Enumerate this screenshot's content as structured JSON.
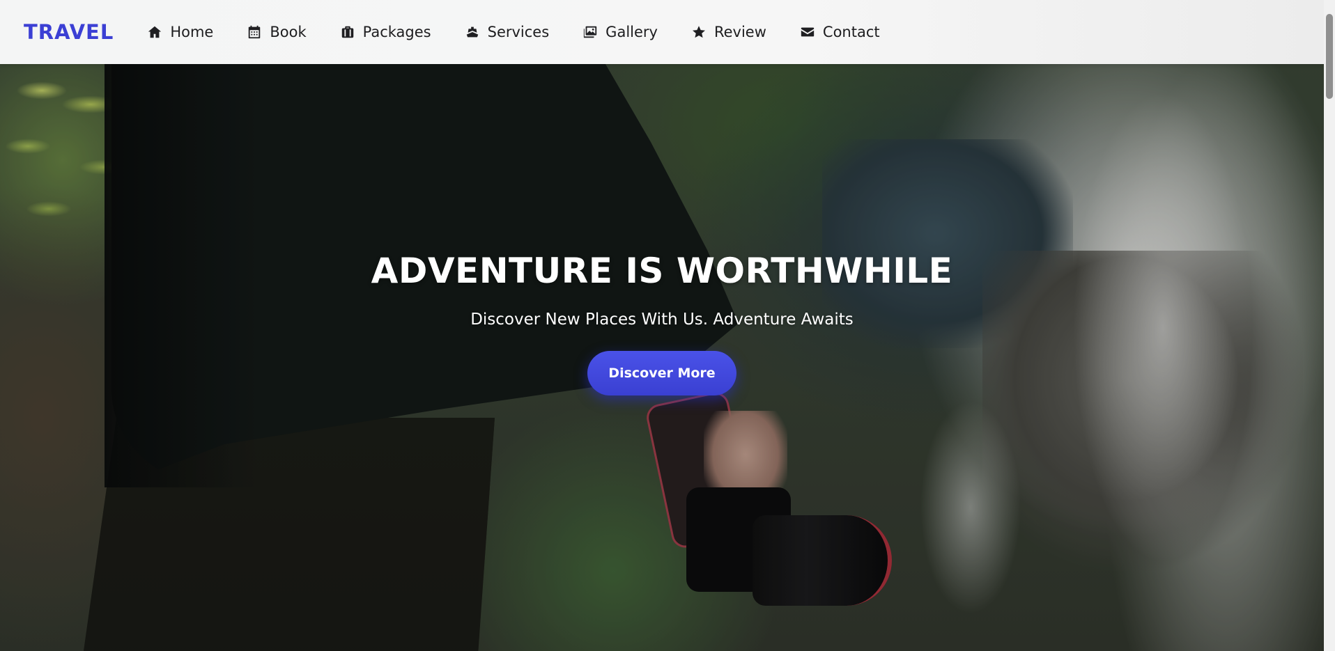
{
  "brand": {
    "logo": "TRAVEL",
    "accent_color": "#3b3fd4"
  },
  "nav": {
    "items": [
      {
        "label": "Home",
        "icon": "home-icon"
      },
      {
        "label": "Book",
        "icon": "calendar-icon"
      },
      {
        "label": "Packages",
        "icon": "suitcase-icon"
      },
      {
        "label": "Services",
        "icon": "ship-icon"
      },
      {
        "label": "Gallery",
        "icon": "images-icon"
      },
      {
        "label": "Review",
        "icon": "star-icon"
      },
      {
        "label": "Contact",
        "icon": "envelope-icon"
      }
    ]
  },
  "hero": {
    "title": "ADVENTURE IS WORTHWHILE",
    "subtitle": "Discover New Places With Us. Adventure Awaits",
    "cta_label": "Discover More",
    "cta_color": "#3f46dc"
  }
}
